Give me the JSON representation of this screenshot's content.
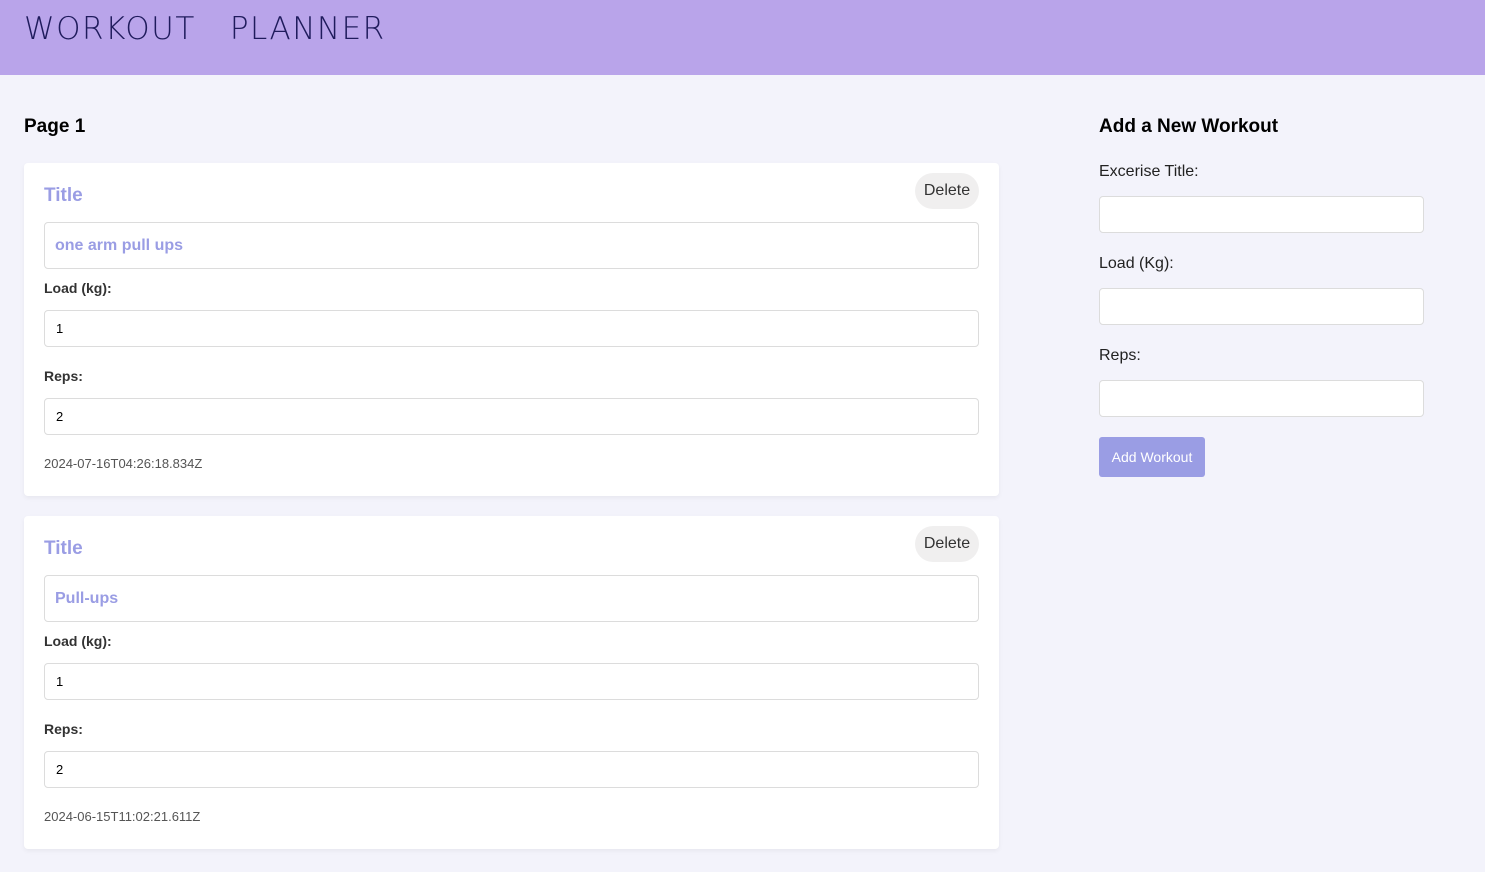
{
  "app": {
    "brand": "WORKOUT   PLANNER"
  },
  "list": {
    "page_label": "Page 1",
    "workouts": [
      {
        "title_label": "Title",
        "title": "one arm pull ups",
        "delete_label": "Delete",
        "load_label": "Load (kg):",
        "load": "1",
        "reps_label": "Reps:",
        "reps": "2",
        "created_at": "2024-07-16T04:26:18.834Z"
      },
      {
        "title_label": "Title",
        "title": "Pull-ups",
        "delete_label": "Delete",
        "load_label": "Load (kg):",
        "load": "1",
        "reps_label": "Reps:",
        "reps": "2",
        "created_at": "2024-06-15T11:02:21.611Z"
      }
    ]
  },
  "form": {
    "heading": "Add a New Workout",
    "title_label": "Excerise Title:",
    "title_value": "",
    "load_label": "Load (Kg):",
    "load_value": "",
    "reps_label": "Reps:",
    "reps_value": "",
    "submit_label": "Add Workout"
  },
  "colors": {
    "header_bg": "#b9a4ea",
    "accent": "#9a9de4",
    "page_bg": "#f3f3fb",
    "brand_text": "#1f1b5c"
  }
}
